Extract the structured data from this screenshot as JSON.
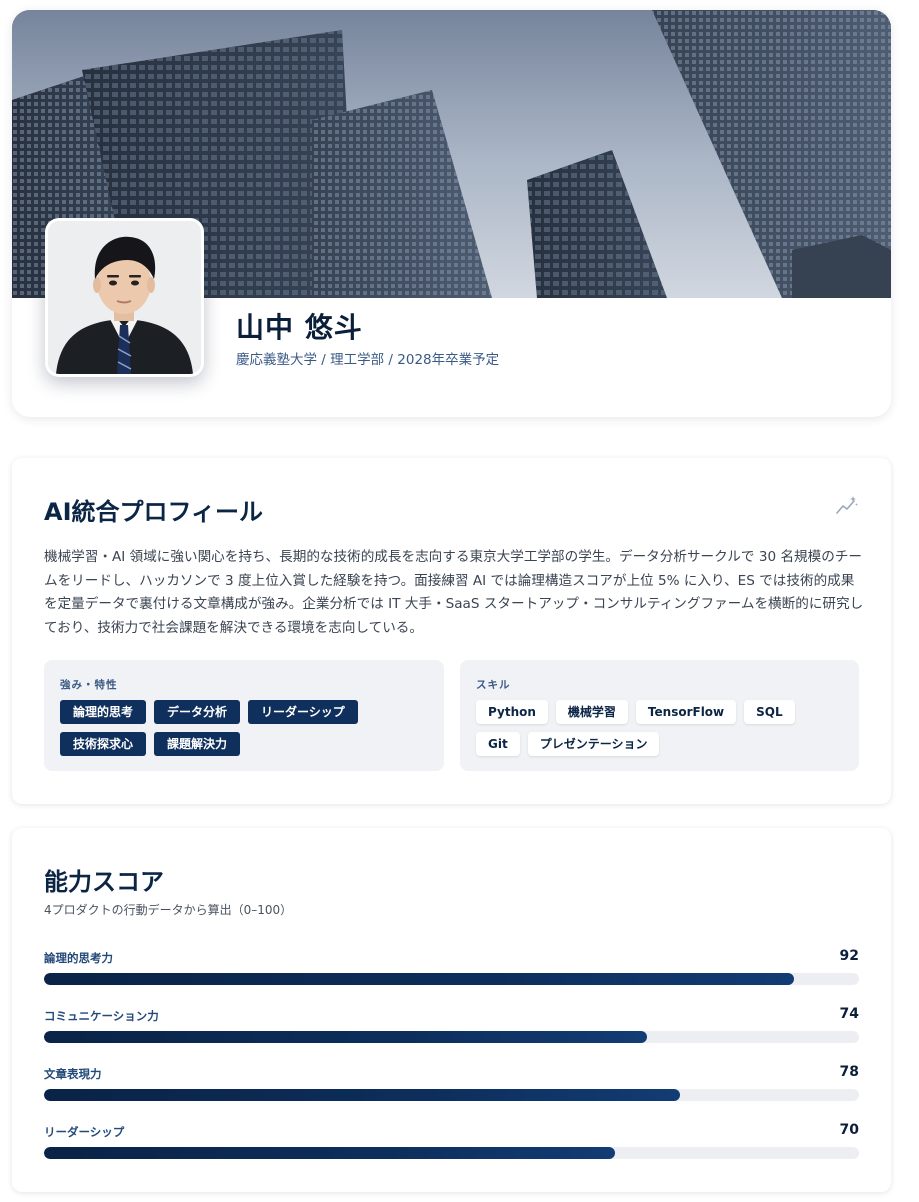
{
  "profile": {
    "name": "山中 悠斗",
    "affiliation": "慶応義塾大学 / 理工学部 / 2028年卒業予定"
  },
  "ai_profile": {
    "title": "AI統合プロフィール",
    "summary": "機械学習・AI 領域に強い関心を持ち、長期的な技術的成長を志向する東京大学工学部の学生。データ分析サークルで 30 名規模のチームをリードし、ハッカソンで 3 度上位入賞した経験を持つ。面接練習 AI では論理構造スコアが上位 5% に入り、ES では技術的成果を定量データで裏付ける文章構成が強み。企業分析では IT 大手・SaaS スタートアップ・コンサルティングファームを横断的に研究しており、技術力で社会課題を解決できる環境を志向している。",
    "strengths_label": "強み・特性",
    "strengths": [
      "論理的思考",
      "データ分析",
      "リーダーシップ",
      "技術探求心",
      "課題解決力"
    ],
    "skills_label": "スキル",
    "skills": [
      "Python",
      "機械学習",
      "TensorFlow",
      "SQL",
      "Git",
      "プレゼンテーション"
    ],
    "sparkle_icon": "sparkle-chart-icon"
  },
  "scores": {
    "title": "能力スコア",
    "subtitle": "4プロダクトの行動データから算出（0–100）",
    "items": [
      {
        "label": "論理的思考力",
        "value": 92
      },
      {
        "label": "コミュニケーション力",
        "value": 74
      },
      {
        "label": "文章表現力",
        "value": 78
      },
      {
        "label": "リーダーシップ",
        "value": 70
      }
    ],
    "max": 100
  },
  "colors": {
    "primary": "#0f2f5c",
    "accent": "#3a5a86",
    "track": "#eceef2"
  }
}
